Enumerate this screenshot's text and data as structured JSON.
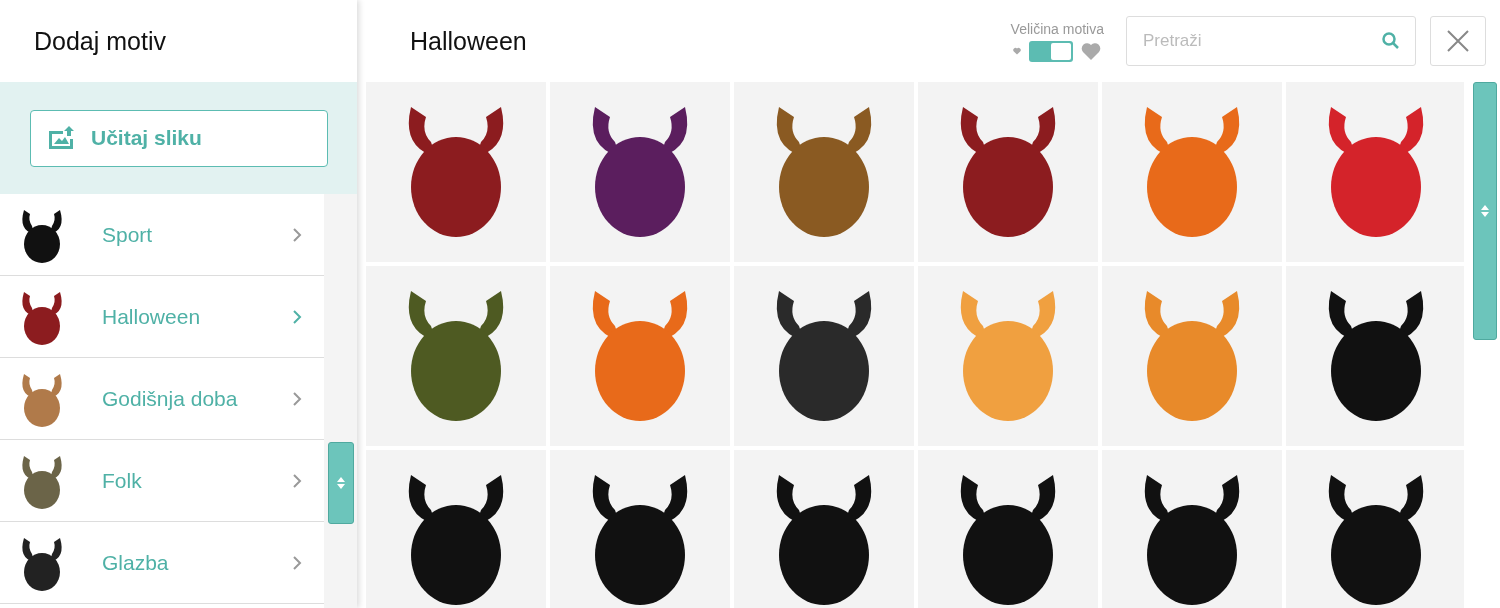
{
  "sidebar": {
    "title": "Dodaj motiv",
    "upload_button": "Učitaj sliku",
    "categories": [
      {
        "label": "Sport",
        "selected": false,
        "color": "#111111"
      },
      {
        "label": "Halloween",
        "selected": true,
        "color": "#8c1c1f"
      },
      {
        "label": "Godišnja doba",
        "selected": false,
        "color": "#b07a4a"
      },
      {
        "label": "Folk",
        "selected": false,
        "color": "#6b6448"
      },
      {
        "label": "Glazba",
        "selected": false,
        "color": "#222222"
      }
    ]
  },
  "main": {
    "title": "Halloween",
    "size_toggle": {
      "label": "Veličina motiva",
      "on": true
    },
    "search": {
      "placeholder": "Pretraži"
    },
    "motifs": [
      {
        "color": "#8c1c1f"
      },
      {
        "color": "#5b1e5e"
      },
      {
        "color": "#8a5a22"
      },
      {
        "color": "#8c1c1f"
      },
      {
        "color": "#e86a1a"
      },
      {
        "color": "#d4232a"
      },
      {
        "color": "#4e5a22"
      },
      {
        "color": "#e86a1a"
      },
      {
        "color": "#2a2a2a"
      },
      {
        "color": "#f0a040"
      },
      {
        "color": "#e88a2a"
      },
      {
        "color": "#111111"
      },
      {
        "color": "#111111"
      },
      {
        "color": "#111111"
      },
      {
        "color": "#111111"
      },
      {
        "color": "#111111"
      },
      {
        "color": "#111111"
      },
      {
        "color": "#111111"
      }
    ]
  }
}
